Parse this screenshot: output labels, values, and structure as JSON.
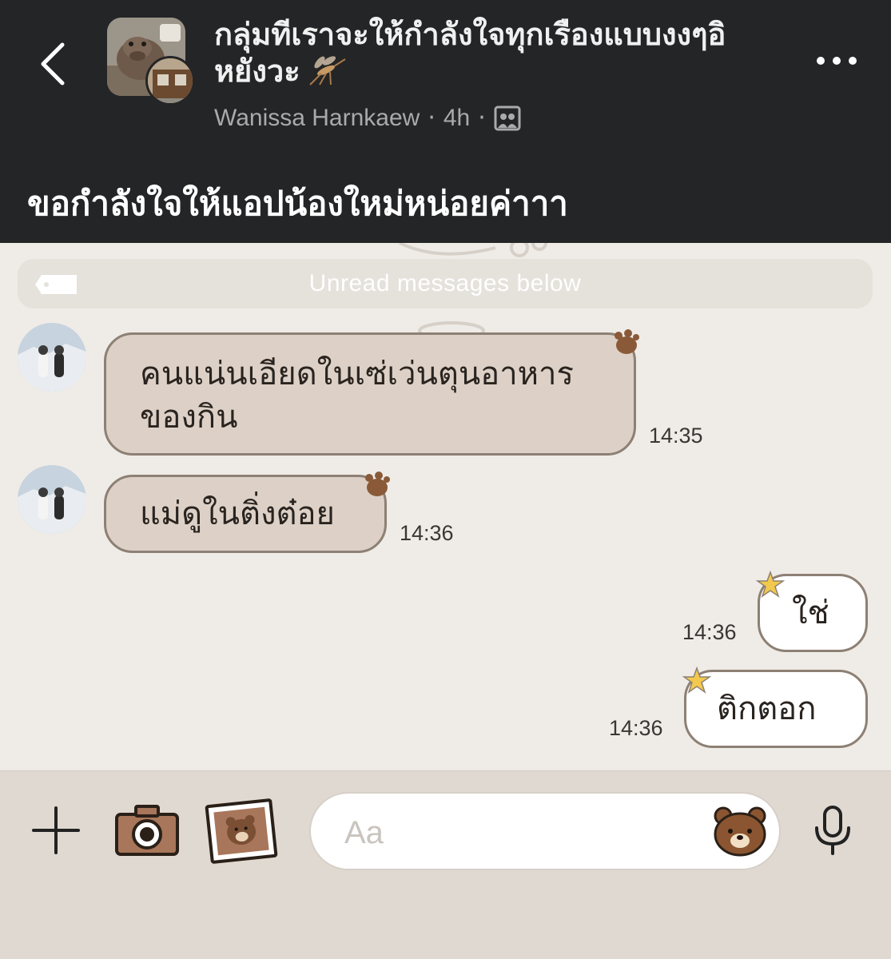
{
  "post": {
    "group_title": "กลุ่มทีเราจะให้กำลังใจทุกเรืองแบบงงๆอิหยังวะ",
    "author": "Wanissa Harnkaew",
    "separator": "·",
    "time_ago": "4h",
    "caption": "ขอกำลังใจให้แอปน้องใหม่หน่อยค่าาา"
  },
  "chat": {
    "unread_banner": "Unread messages below",
    "messages": [
      {
        "direction": "in",
        "line1": "คนแน่นเอียดในเซ่เว่นตุนอาหาร",
        "line2": "ของกิน",
        "time": "14:35"
      },
      {
        "direction": "in",
        "line1": "แม่ดูในติ่งต๋อย",
        "time": "14:36"
      },
      {
        "direction": "out",
        "line1": "ใช่",
        "time": "14:36"
      },
      {
        "direction": "out",
        "line1": "ติกตอก",
        "time": "14:36"
      }
    ]
  },
  "input": {
    "placeholder": "Aa"
  },
  "icons": {
    "back": "chevron-left-icon",
    "more": "more-horizontal-icon",
    "privacy": "group-privacy-icon",
    "add": "plus-icon",
    "camera": "camera-icon",
    "gallery": "photo-frame-icon",
    "sticker": "bear-sticker-icon",
    "mic": "microphone-icon"
  },
  "colors": {
    "header_bg": "#242526",
    "chat_bg": "#efece7",
    "incoming_bubble": "#ddd1c7",
    "outgoing_bubble": "#ffffff",
    "bubble_border": "#8d8074",
    "input_bar_bg": "#e0d9d1"
  }
}
